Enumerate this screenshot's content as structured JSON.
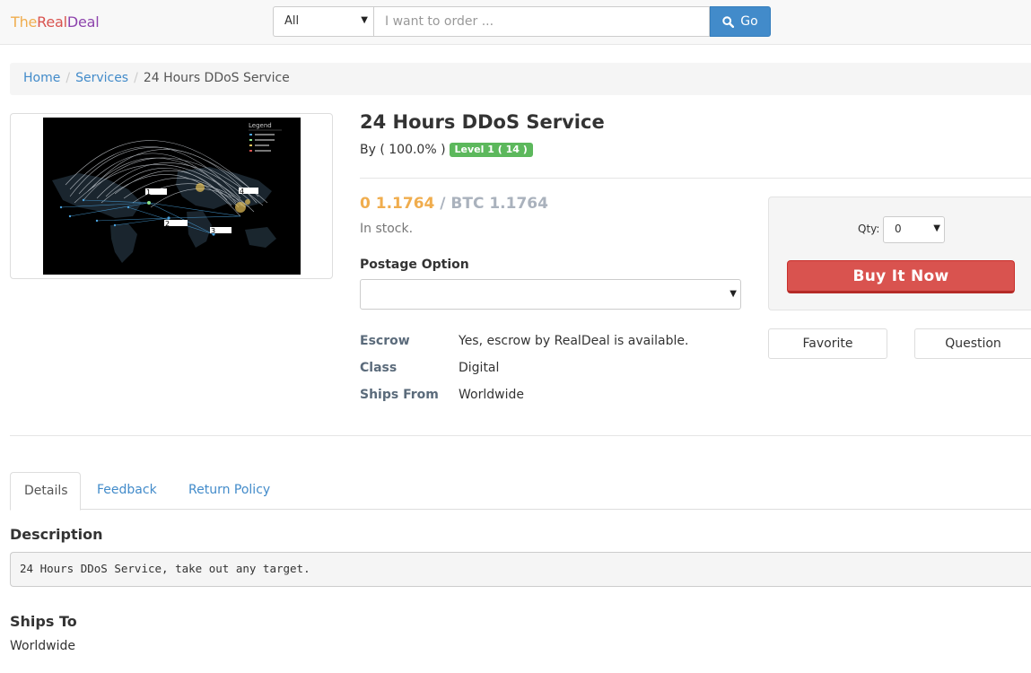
{
  "brand": {
    "part1": "The",
    "part2": "Real",
    "part3": "Deal"
  },
  "search": {
    "category": "All",
    "placeholder": "I want to order ...",
    "button_label": "Go"
  },
  "breadcrumb": {
    "items": [
      "Home",
      "Services"
    ],
    "current": "24 Hours DDoS Service"
  },
  "product": {
    "image_alt": "DDoS attack map with Legend",
    "image_legend": {
      "title": "Legend",
      "markers": [
        "1",
        "2",
        "3",
        "4"
      ]
    },
    "title": "24 Hours DDoS Service",
    "byline": "By ( 100.0% )",
    "level_badge": "Level 1 ( 14 )",
    "price_primary": "0 1.1764",
    "price_secondary": "/ BTC 1.1764",
    "stock": "In stock.",
    "postage_label": "Postage Option",
    "postage_value": "",
    "specs": [
      {
        "key": "Escrow",
        "value": "Yes, escrow by RealDeal is available."
      },
      {
        "key": "Class",
        "value": "Digital"
      },
      {
        "key": "Ships From",
        "value": "Worldwide"
      }
    ]
  },
  "buy_panel": {
    "qty_label": "Qty:",
    "qty_value": "0",
    "buy_button": "Buy It Now",
    "favorite_button": "Favorite",
    "question_button": "Question"
  },
  "tabs": [
    {
      "label": "Details",
      "active": true
    },
    {
      "label": "Feedback",
      "active": false
    },
    {
      "label": "Return Policy",
      "active": false
    }
  ],
  "details": {
    "description_heading": "Description",
    "description_text": "24 Hours DDoS Service, take out any target.",
    "ships_to_heading": "Ships To",
    "ships_to_value": "Worldwide"
  },
  "colors": {
    "accent_blue": "#428bca",
    "buy_red": "#d9534f",
    "price_orange": "#f0ad4e",
    "badge_green": "#5cb85c"
  },
  "icons": {
    "search_button": "search-icon",
    "select_caret": "caret-down-icon"
  }
}
